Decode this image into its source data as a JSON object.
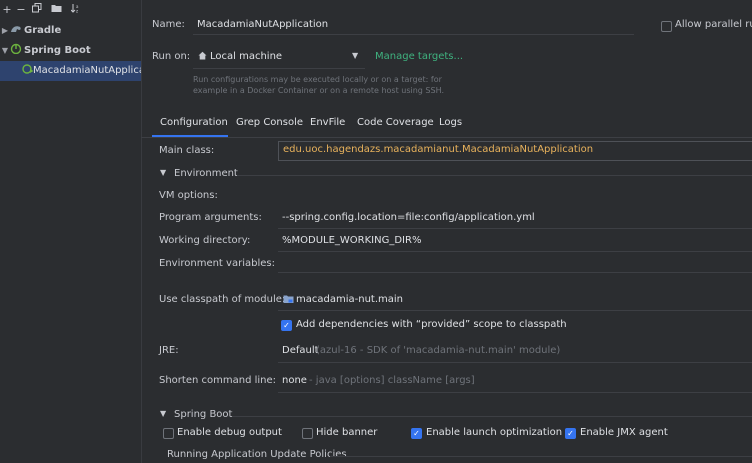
{
  "sidebar": {
    "toolbar": [
      "+",
      "−",
      "copy",
      "folder",
      "sort"
    ],
    "items": [
      {
        "label": "Gradle",
        "expanded": false,
        "icon": "gradle-icon"
      },
      {
        "label": "Spring Boot",
        "expanded": true,
        "icon": "spring-boot-icon"
      },
      {
        "label": "MacadamiaNutApplication",
        "icon": "spring-boot-run-icon",
        "selected": true
      }
    ]
  },
  "config": {
    "name_label": "Name:",
    "name_value": "MacadamiaNutApplication",
    "allow_parallel_label": "Allow parallel run",
    "run_on_label": "Run on:",
    "run_on_value": "Local machine",
    "manage_targets": "Manage targets...",
    "hint_line1": "Run configurations may be executed locally or on a target: for",
    "hint_line2": "example in a Docker Container or on a remote host using SSH."
  },
  "tabs": [
    {
      "label": "Configuration",
      "active": true
    },
    {
      "label": "Grep Console"
    },
    {
      "label": "EnvFile"
    },
    {
      "label": "Code Coverage"
    },
    {
      "label": "Logs"
    }
  ],
  "form": {
    "main_class_label": "Main class:",
    "main_class_value": "edu.uoc.hagendazs.macadamianut.MacadamiaNutApplication",
    "environment_section": "Environment",
    "vm_options_label": "VM options:",
    "program_args_label": "Program arguments:",
    "program_args_value": "--spring.config.location=file:config/application.yml",
    "working_dir_label": "Working directory:",
    "working_dir_value": "%MODULE_WORKING_DIR%",
    "env_vars_label": "Environment variables:",
    "classpath_label": "Use classpath of module:",
    "classpath_value": "macadamia-nut.main",
    "add_deps_label": "Add dependencies with “provided” scope to classpath",
    "jre_label": "JRE:",
    "jre_value": "Default",
    "jre_detail": "(azul-16 - SDK of 'macadamia-nut.main' module)",
    "shorten_label": "Shorten command line:",
    "shorten_value": "none",
    "shorten_detail": "- java [options] className [args]"
  },
  "spring_boot": {
    "section": "Spring Boot",
    "debug_output": "Enable debug output",
    "hide_banner": "Hide banner",
    "launch_opt": "Enable launch optimization",
    "jmx_agent": "Enable JMX agent",
    "update_policies": "Running Application Update Policies"
  },
  "colors": {
    "accent": "#3574f0",
    "link": "#3fb27f",
    "spring": "#6db33f",
    "main_class": "#e8b25c"
  }
}
